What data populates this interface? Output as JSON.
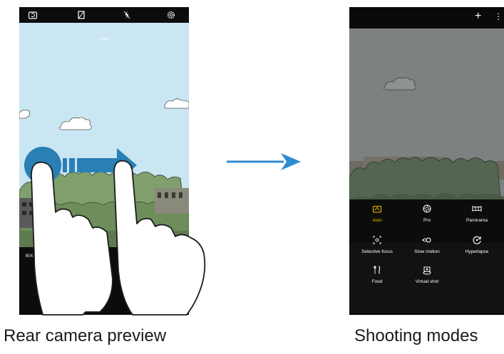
{
  "left_phone": {
    "top_label": "Auto",
    "mode_strip_label": "BIXBY"
  },
  "right_phone": {
    "modes": [
      {
        "icon": "auto-icon",
        "label": "Auto",
        "active": true
      },
      {
        "icon": "aperture-icon",
        "label": "Pro",
        "active": false
      },
      {
        "icon": "panorama-icon",
        "label": "Panorama",
        "active": false
      },
      {
        "icon": "selective-focus-icon",
        "label": "Selective focus",
        "active": false
      },
      {
        "icon": "slow-motion-icon",
        "label": "Slow motion",
        "active": false
      },
      {
        "icon": "hyperlapse-icon",
        "label": "Hyperlapse",
        "active": false
      },
      {
        "icon": "food-icon",
        "label": "Food",
        "active": false
      },
      {
        "icon": "virtual-shot-icon",
        "label": "Virtual shot",
        "active": false
      }
    ]
  },
  "captions": {
    "left": "Rear camera preview",
    "right": "Shooting modes"
  },
  "colors": {
    "swipe_arrow": "#2a7fb5",
    "transition_arrow": "#2e8bd1",
    "active_mode": "#f2b705"
  }
}
